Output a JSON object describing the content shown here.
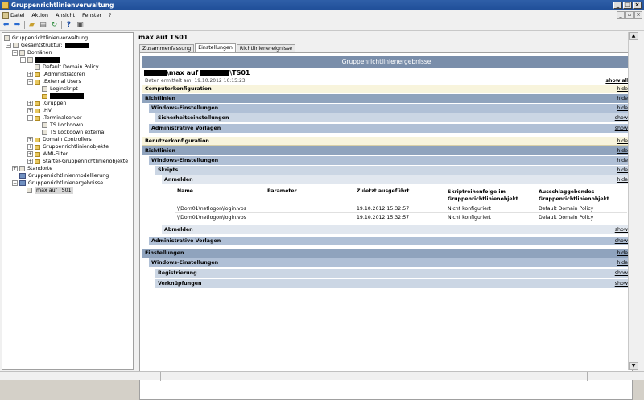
{
  "window": {
    "title": "Gruppenrichtlinienverwaltung"
  },
  "menu": [
    "Datei",
    "Aktion",
    "Ansicht",
    "Fenster",
    "?"
  ],
  "toolbar": {
    "icons": [
      "back-arrow-icon",
      "forward-arrow-icon",
      "folder-icon",
      "properties-icon",
      "refresh-icon",
      "help-icon",
      "console-icon"
    ]
  },
  "tree": {
    "root": "Gruppenrichtlinienverwaltung",
    "forest": "Gesamtstruktur:",
    "domains": "Domänen",
    "items": [
      "Default Domain Policy",
      ".Administratoren",
      ".External Users",
      "Loginskript",
      ".Gruppen",
      ".HV",
      ".Terminalserver",
      "TS Lockdown",
      "TS Lockdown external",
      "Domain Controllers",
      "Gruppenrichtlinienobjekte",
      "WMI-Filter",
      "Starter-Gruppenrichtlinienobjekte",
      "Standorte",
      "Gruppenrichtlinienmodellierung",
      "Gruppenrichtlinienergebnisse",
      "max auf TS01"
    ]
  },
  "panel": {
    "title": "max auf TS01",
    "tabs": [
      "Zusammenfassung",
      "Einstellungen",
      "Richtlinienereignisse"
    ],
    "active_tab": "Einstellungen"
  },
  "report": {
    "header": "Gruppenrichtlinienergebnisse",
    "title_mid": "\\max auf",
    "title_end": "\\TS01",
    "date": "Daten ermittelt am: 19.10.2012 16:15:23",
    "show_all": "show all",
    "sections": [
      "Computerkonfiguration",
      "Richtlinien",
      "Windows-Einstellungen",
      "Sicherheitseinstellungen",
      "Administrative Vorlagen",
      "Benutzerkonfiguration",
      "Richtlinien",
      "Windows-Einstellungen",
      "Skripts",
      "Anmelden",
      "Abmelden",
      "Administrative Vorlagen",
      "Einstellungen",
      "Windows-Einstellungen",
      "Registrierung",
      "Verknüpfungen"
    ],
    "actions": [
      "hide",
      "hide",
      "hide",
      "show",
      "show",
      "hide",
      "hide",
      "hide",
      "hide",
      "hide",
      "show",
      "show",
      "hide",
      "hide",
      "show",
      "show"
    ],
    "table": {
      "headers": [
        "Name",
        "Parameter",
        "Zuletzt ausgeführt",
        "Skriptreihenfolge im Gruppenrichtlinienobjekt",
        "Ausschlaggebendes Gruppenrichtlinienobjekt"
      ],
      "rows": [
        [
          "\\\\Dom01\\netlogon\\login.vbs",
          "",
          "19.10.2012 15:32:57",
          "Nicht konfiguriert",
          "Default Domain Policy"
        ],
        [
          "\\\\Dom01\\netlogon\\login.vbs",
          "",
          "19.10.2012 15:32:57",
          "Nicht konfiguriert",
          "Default Domain Policy"
        ]
      ]
    }
  }
}
